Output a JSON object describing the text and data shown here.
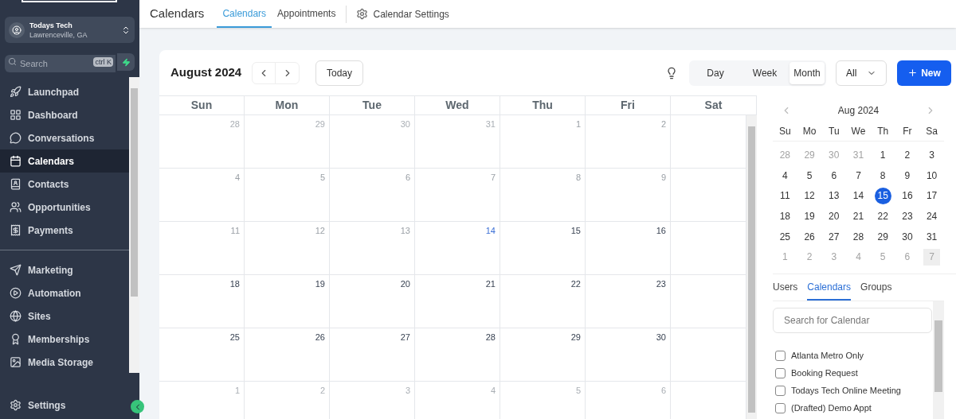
{
  "sidebar": {
    "account": {
      "name": "Todays Tech",
      "location": "Lawrenceville, GA"
    },
    "search": {
      "placeholder": "Search",
      "shortcut": "ctrl K"
    },
    "nav_groups": [
      [
        {
          "label": "Launchpad",
          "selected": false
        },
        {
          "label": "Dashboard",
          "selected": false
        },
        {
          "label": "Conversations",
          "selected": false
        },
        {
          "label": "Calendars",
          "selected": true
        },
        {
          "label": "Contacts",
          "selected": false
        },
        {
          "label": "Opportunities",
          "selected": false
        },
        {
          "label": "Payments",
          "selected": false
        }
      ],
      [
        {
          "label": "Marketing",
          "selected": false
        },
        {
          "label": "Automation",
          "selected": false
        },
        {
          "label": "Sites",
          "selected": false
        },
        {
          "label": "Memberships",
          "selected": false
        },
        {
          "label": "Media Storage",
          "selected": false
        }
      ]
    ],
    "footer_item": {
      "label": "Settings"
    }
  },
  "topbar": {
    "title": "Calendars",
    "tabs": [
      {
        "label": "Calendars",
        "selected": true
      },
      {
        "label": "Appointments",
        "selected": false
      }
    ],
    "settings_link": "Calendar Settings"
  },
  "toolbar": {
    "month_title": "August 2024",
    "today_button": "Today",
    "views": [
      {
        "label": "Day",
        "selected": false
      },
      {
        "label": "Week",
        "selected": false
      },
      {
        "label": "Month",
        "selected": true
      }
    ],
    "filter": "All",
    "new_button": "New"
  },
  "month_grid": {
    "weekdays": [
      "Sun",
      "Mon",
      "Tue",
      "Wed",
      "Thu",
      "Fri",
      "Sat"
    ],
    "weeks": [
      [
        {
          "day": "28",
          "kind": "outside"
        },
        {
          "day": "29",
          "kind": "outside"
        },
        {
          "day": "30",
          "kind": "outside"
        },
        {
          "day": "31",
          "kind": "outside"
        },
        {
          "day": "1",
          "kind": "past"
        },
        {
          "day": "2",
          "kind": "past"
        }
      ],
      [
        {
          "day": "4",
          "kind": "past"
        },
        {
          "day": "5",
          "kind": "past"
        },
        {
          "day": "6",
          "kind": "past"
        },
        {
          "day": "7",
          "kind": "past"
        },
        {
          "day": "8",
          "kind": "past"
        },
        {
          "day": "9",
          "kind": "past"
        }
      ],
      [
        {
          "day": "11",
          "kind": "past"
        },
        {
          "day": "12",
          "kind": "past"
        },
        {
          "day": "13",
          "kind": "past"
        },
        {
          "day": "14",
          "kind": "today"
        },
        {
          "day": "15",
          "kind": "future"
        },
        {
          "day": "16",
          "kind": "future"
        }
      ],
      [
        {
          "day": "18",
          "kind": "future"
        },
        {
          "day": "19",
          "kind": "future"
        },
        {
          "day": "20",
          "kind": "future"
        },
        {
          "day": "21",
          "kind": "future"
        },
        {
          "day": "22",
          "kind": "future"
        },
        {
          "day": "23",
          "kind": "future"
        }
      ],
      [
        {
          "day": "25",
          "kind": "future"
        },
        {
          "day": "26",
          "kind": "future"
        },
        {
          "day": "27",
          "kind": "future"
        },
        {
          "day": "28",
          "kind": "future"
        },
        {
          "day": "29",
          "kind": "future"
        },
        {
          "day": "30",
          "kind": "future"
        }
      ],
      [
        {
          "day": "1",
          "kind": "outside"
        },
        {
          "day": "2",
          "kind": "outside"
        },
        {
          "day": "3",
          "kind": "outside"
        },
        {
          "day": "4",
          "kind": "outside"
        },
        {
          "day": "5",
          "kind": "outside"
        },
        {
          "day": "6",
          "kind": "outside"
        }
      ]
    ]
  },
  "mini_calendar": {
    "title": "Aug 2024",
    "weekdays": [
      "Su",
      "Mo",
      "Tu",
      "We",
      "Th",
      "Fr",
      "Sa"
    ],
    "weeks": [
      [
        {
          "day": "28",
          "outside": true,
          "selected": false
        },
        {
          "day": "29",
          "outside": true,
          "selected": false
        },
        {
          "day": "30",
          "outside": true,
          "selected": false
        },
        {
          "day": "31",
          "outside": true,
          "selected": false
        },
        {
          "day": "1",
          "outside": false,
          "selected": false
        },
        {
          "day": "2",
          "outside": false,
          "selected": false
        },
        {
          "day": "3",
          "outside": false,
          "selected": false
        }
      ],
      [
        {
          "day": "4",
          "outside": false,
          "selected": false
        },
        {
          "day": "5",
          "outside": false,
          "selected": false
        },
        {
          "day": "6",
          "outside": false,
          "selected": false
        },
        {
          "day": "7",
          "outside": false,
          "selected": false
        },
        {
          "day": "8",
          "outside": false,
          "selected": false
        },
        {
          "day": "9",
          "outside": false,
          "selected": false
        },
        {
          "day": "10",
          "outside": false,
          "selected": false
        }
      ],
      [
        {
          "day": "11",
          "outside": false,
          "selected": false
        },
        {
          "day": "12",
          "outside": false,
          "selected": false
        },
        {
          "day": "13",
          "outside": false,
          "selected": false
        },
        {
          "day": "14",
          "outside": false,
          "selected": false
        },
        {
          "day": "15",
          "outside": false,
          "selected": true
        },
        {
          "day": "16",
          "outside": false,
          "selected": false
        },
        {
          "day": "17",
          "outside": false,
          "selected": false
        }
      ],
      [
        {
          "day": "18",
          "outside": false,
          "selected": false
        },
        {
          "day": "19",
          "outside": false,
          "selected": false
        },
        {
          "day": "20",
          "outside": false,
          "selected": false
        },
        {
          "day": "21",
          "outside": false,
          "selected": false
        },
        {
          "day": "22",
          "outside": false,
          "selected": false
        },
        {
          "day": "23",
          "outside": false,
          "selected": false
        },
        {
          "day": "24",
          "outside": false,
          "selected": false
        }
      ],
      [
        {
          "day": "25",
          "outside": false,
          "selected": false
        },
        {
          "day": "26",
          "outside": false,
          "selected": false
        },
        {
          "day": "27",
          "outside": false,
          "selected": false
        },
        {
          "day": "28",
          "outside": false,
          "selected": false
        },
        {
          "day": "29",
          "outside": false,
          "selected": false
        },
        {
          "day": "30",
          "outside": false,
          "selected": false
        },
        {
          "day": "31",
          "outside": false,
          "selected": false
        }
      ],
      [
        {
          "day": "1",
          "outside": true,
          "selected": false
        },
        {
          "day": "2",
          "outside": true,
          "selected": false
        },
        {
          "day": "3",
          "outside": true,
          "selected": false
        },
        {
          "day": "4",
          "outside": true,
          "selected": false
        },
        {
          "day": "5",
          "outside": true,
          "selected": false
        },
        {
          "day": "6",
          "outside": true,
          "selected": false
        },
        {
          "day": "7",
          "outside": true,
          "selected": false,
          "hovered": true
        }
      ]
    ]
  },
  "panel_tabs": [
    {
      "label": "Users",
      "selected": false
    },
    {
      "label": "Calendars",
      "selected": true
    },
    {
      "label": "Groups",
      "selected": false
    }
  ],
  "calendar_search": {
    "placeholder": "Search for Calendar"
  },
  "calendar_list": [
    {
      "label": "Atlanta Metro Only",
      "checked": false
    },
    {
      "label": "Booking Request",
      "checked": false
    },
    {
      "label": "Todays Tech Online Meeting",
      "checked": false
    },
    {
      "label": "(Drafted) Demo Appt",
      "checked": false
    }
  ]
}
